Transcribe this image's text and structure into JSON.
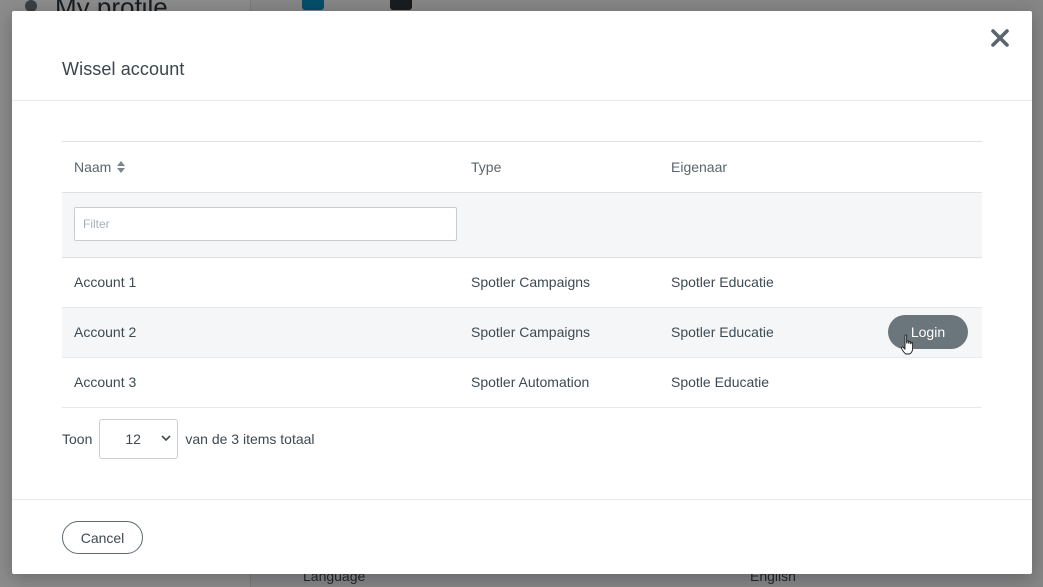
{
  "background": {
    "page_title": "My profile",
    "row_label": "Language",
    "row_value": "English"
  },
  "modal": {
    "title": "Wissel account",
    "close_icon": "close-icon"
  },
  "table": {
    "columns": {
      "name": "Naam",
      "type": "Type",
      "owner": "Eigenaar"
    },
    "filter_placeholder": "Filter",
    "rows": [
      {
        "name": "Account 1",
        "type": "Spotler Campaigns",
        "owner": "Spotler Educatie"
      },
      {
        "name": "Account 2",
        "type": "Spotler Campaigns",
        "owner": "Spotler Educatie"
      },
      {
        "name": "Account 3",
        "type": "Spotler Automation",
        "owner": "Spotle Educatie"
      }
    ],
    "login_label": "Login"
  },
  "pager": {
    "show_label": "Toon",
    "page_size": "12",
    "total_text": "van de 3 items totaal"
  },
  "footer": {
    "cancel_label": "Cancel"
  },
  "colors": {
    "login_button": "#6a757c",
    "text": "#3d4a52",
    "overlay": "rgba(0,0,0,0.45)"
  }
}
